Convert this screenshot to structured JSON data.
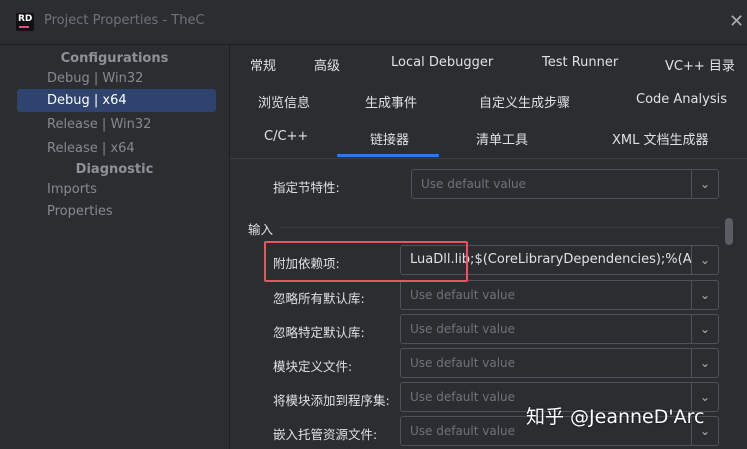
{
  "window": {
    "title": "Project Properties - TheC",
    "logo_text": "RD"
  },
  "sidebar": {
    "configurations_header": "Configurations",
    "configurations": [
      {
        "label": "Debug | Win32"
      },
      {
        "label": "Debug | x64",
        "selected": true
      },
      {
        "label": "Release | Win32"
      },
      {
        "label": "Release | x64"
      }
    ],
    "diagnostic_header": "Diagnostic",
    "diagnostic": [
      {
        "label": "Imports"
      },
      {
        "label": "Properties"
      }
    ]
  },
  "tabs": [
    [
      "常规",
      "高级",
      "Local Debugger",
      "Test Runner",
      "VC++ 目录"
    ],
    [
      "浏览信息",
      "生成事件",
      "自定义生成步骤",
      "Code Analysis"
    ],
    [
      "C/C++",
      "链接器",
      "清单工具",
      "XML 文档生成器"
    ]
  ],
  "active_tab": "链接器",
  "settings": {
    "align_label": "指定节特性:",
    "align_value": "Use default value",
    "section_title": "输入",
    "rows": [
      {
        "label": "附加依赖项:",
        "value": "LuaDll.lib;$(CoreLibraryDependencies);%(AdditionalDependencies)"
      },
      {
        "label": "忽略所有默认库:",
        "value": "Use default value"
      },
      {
        "label": "忽略特定默认库:",
        "value": "Use default value"
      },
      {
        "label": "模块定义文件:",
        "value": "Use default value"
      },
      {
        "label": "将模块添加到程序集:",
        "value": "Use default value"
      },
      {
        "label": "嵌入托管资源文件:",
        "value": "Use default value"
      }
    ]
  },
  "watermark": "知乎 @JeanneD'Arc",
  "colors": {
    "accent": "#3574f0",
    "selection": "#2e436e",
    "highlight_box": "#e9545e"
  }
}
